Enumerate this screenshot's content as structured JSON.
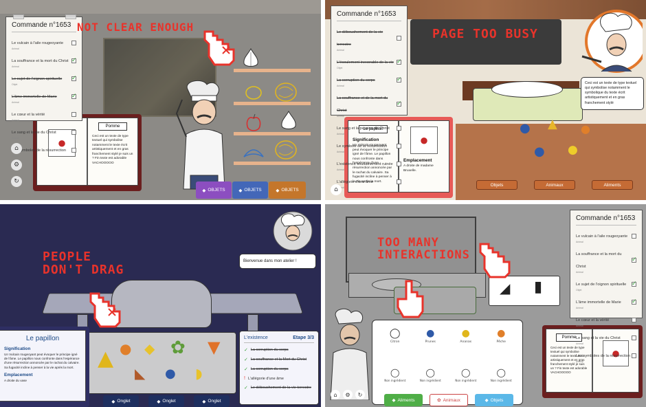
{
  "panel1": {
    "title": "NOT CLEAR ENOUGH",
    "order": {
      "title": "Commande n°1653",
      "items": [
        {
          "label": "Le vulcain à l'aile rougeoyante",
          "sub": "Animal",
          "done": false,
          "checked": false
        },
        {
          "label": "La souffrance et la mort du Christ",
          "sub": "Animal",
          "done": false,
          "checked": true
        },
        {
          "label": "Le sujet de l'oignon spirituelle",
          "sub": "Objet",
          "done": true,
          "checked": true
        },
        {
          "label": "L'âme immortelle de Marie",
          "sub": "Animal",
          "done": true,
          "checked": true
        },
        {
          "label": "Le cœur et la vérité",
          "sub": "Animal",
          "done": false,
          "checked": false
        },
        {
          "label": "Le sang et la vie du Christ",
          "sub": "Animal",
          "done": false,
          "checked": false
        },
        {
          "label": "Les symboles de la résurrection",
          "sub": "Animal",
          "done": false,
          "checked": false
        }
      ]
    },
    "book": {
      "tag": "Pomme",
      "text": "Ceci est un texte de type textuel qui symbolise notamment le texte écrit artistiquement et en gras franchement stylé je suis un ? Fin texte est adorable VACHOOOOO"
    },
    "buttons": [
      "OBJETS",
      "OBJETS",
      "OBJETS"
    ],
    "colors": {
      "b1": "#8c4ec0",
      "b2": "#4367b8",
      "b3": "#c4762b"
    }
  },
  "panel2": {
    "title": "PAGE TOO BUSY",
    "order": {
      "title": "Commande n°1653",
      "items": [
        {
          "label": "Le débouchement de la vie terrestre",
          "sub": "Animal",
          "done": true,
          "checked": false
        },
        {
          "label": "L'écoulement inexorable de la vie",
          "sub": "Objet",
          "done": true,
          "checked": true
        },
        {
          "label": "La corruption du corps",
          "sub": "Animal",
          "done": true,
          "checked": true
        },
        {
          "label": "La souffrance et de la mort du Christ",
          "sub": "Animal",
          "done": true,
          "checked": true
        },
        {
          "label": "Le sang et la passion du Christ",
          "sub": "Animal",
          "done": false,
          "checked": false
        },
        {
          "label": "Le symbole de la résurrection",
          "sub": "Animal",
          "done": false,
          "checked": false
        },
        {
          "label": "L'existence soudainement ruinée",
          "sub": "Animal",
          "done": false,
          "checked": false
        },
        {
          "label": "L'allégorie d'une âme",
          "sub": "Animal",
          "done": false,
          "checked": false
        }
      ]
    },
    "bubble": "Ceci est un texte de type textuel qui symbolise notamment le symbolique du texte écrit artistiquement et en gras franchement stylé",
    "book": {
      "tag": "Le papillon",
      "h1": "Signification",
      "t1": "Un Vulcain rougeoyant peut évoquer le principe igné de l'âme. Le papillon nous confronte dans l'espérance d'une résurrection annoncée par le rachat du calvaire. Sa fugacité incline à penser à la vie après la mort.",
      "h2": "Emplacement",
      "t2": "A droite de madame Bruxelle."
    },
    "buttons": [
      "Objets",
      "Animaux",
      "Aliments"
    ]
  },
  "panel3": {
    "title": "PEOPLE\nDON'T DRAG",
    "bubble": "Bienvenue dans mon atelier !",
    "book": {
      "tag": "Le papillon",
      "h1": "Signification",
      "t1": "Un Vulcain rougeoyant peut évoquer le principe igné de l'âme. Le papillon nous confronte dans l'espérance d'une résurrection annoncée par le rachat du calvaire. Sa fugacité incline à penser à la vie après la mort.",
      "h2": "Emplacement",
      "t2": "A droite du vase"
    },
    "list": {
      "title": "L'existence",
      "step": "Etape 3/3",
      "items": [
        {
          "label": "La corruption du corps",
          "done": true
        },
        {
          "label": "La souffrance et la Mort du Christ",
          "done": true
        },
        {
          "label": "La corruption du corps",
          "done": true
        },
        {
          "label": "L'allégorie d'une âme",
          "done": false
        },
        {
          "label": "Le débouchement de la vie terrestre",
          "done": true
        }
      ]
    },
    "buttons": [
      "Onglet",
      "Onglet",
      "Onglet"
    ]
  },
  "panel4": {
    "title": "TOO MANY\nINTERACTIONS",
    "order": {
      "title": "Commande n°1653",
      "items": [
        {
          "label": "Le vulcain à l'aile rougeoyante",
          "sub": "Animal",
          "done": false,
          "checked": false
        },
        {
          "label": "La souffrance et la mort du Christ",
          "sub": "Animal",
          "done": false,
          "checked": true
        },
        {
          "label": "Le sujet de l'oignon spirituelle",
          "sub": "Objet",
          "done": false,
          "checked": true
        },
        {
          "label": "L'âme immortelle de Marie",
          "sub": "Animal",
          "done": false,
          "checked": true
        },
        {
          "label": "Le cœur et la vérité",
          "sub": "Animal",
          "done": false,
          "checked": false
        },
        {
          "label": "Le sang et la vie du Christ",
          "sub": "Animal",
          "done": false,
          "checked": false
        },
        {
          "label": "Les symboles de la résurrection",
          "sub": "Animal",
          "done": false,
          "checked": false
        }
      ]
    },
    "slots": [
      "Citron",
      "Prunes",
      "Ananas",
      "Pêche"
    ],
    "empty_slots": [
      "Non ingrédient",
      "Non ingrédient",
      "Non ingrédient",
      "Non ingrédient"
    ],
    "book": {
      "tag": "Pomme",
      "text": "Ceci est un texte de type textuel qui symbolise notamment le texte écrit artistiquement et en gras franchement stylé je suis un ? Fin texte est adorable VACHOOOOO"
    },
    "buttons": [
      "Aliments",
      "Animaux",
      "Objets"
    ],
    "colors": {
      "b1": "#4fae47",
      "b2": "#ffffff",
      "b3": "#5bb8e8"
    }
  }
}
